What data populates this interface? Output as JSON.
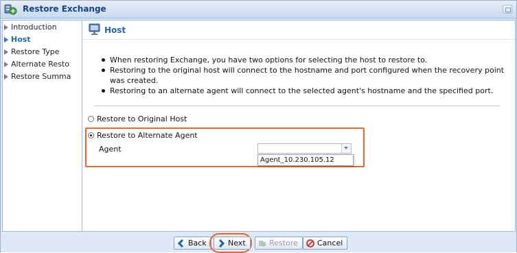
{
  "window": {
    "title": "Restore Exchange"
  },
  "nav": {
    "items": [
      {
        "label": "Introduction",
        "active": false
      },
      {
        "label": "Host",
        "active": true
      },
      {
        "label": "Restore Type",
        "active": false
      },
      {
        "label": "Alternate Resto",
        "active": false
      },
      {
        "label": "Restore Summa",
        "active": false
      }
    ]
  },
  "section": {
    "title": "Host",
    "bullets": [
      "When restoring Exchange, you have two options for selecting the host to restore to.",
      "Restoring to the original host will connect to the hostname and port configured when the recovery point was created.",
      "Restoring to an alternate agent will connect to the selected agent's hostname and the specified port."
    ]
  },
  "options": {
    "original_label": "Restore to Original Host",
    "alternate_label": "Restore to Alternate Agent",
    "selected": "alternate"
  },
  "agent": {
    "label": "Agent",
    "value": "",
    "dropdown_options": [
      "Agent_10.230.105.12"
    ]
  },
  "footer": {
    "back_label": "Back",
    "next_label": "Next",
    "restore_label": "Restore",
    "cancel_label": "Cancel"
  },
  "colors": {
    "accent": "#1f65c4",
    "highlight": "#e8662b",
    "title_text": "#15428b"
  }
}
